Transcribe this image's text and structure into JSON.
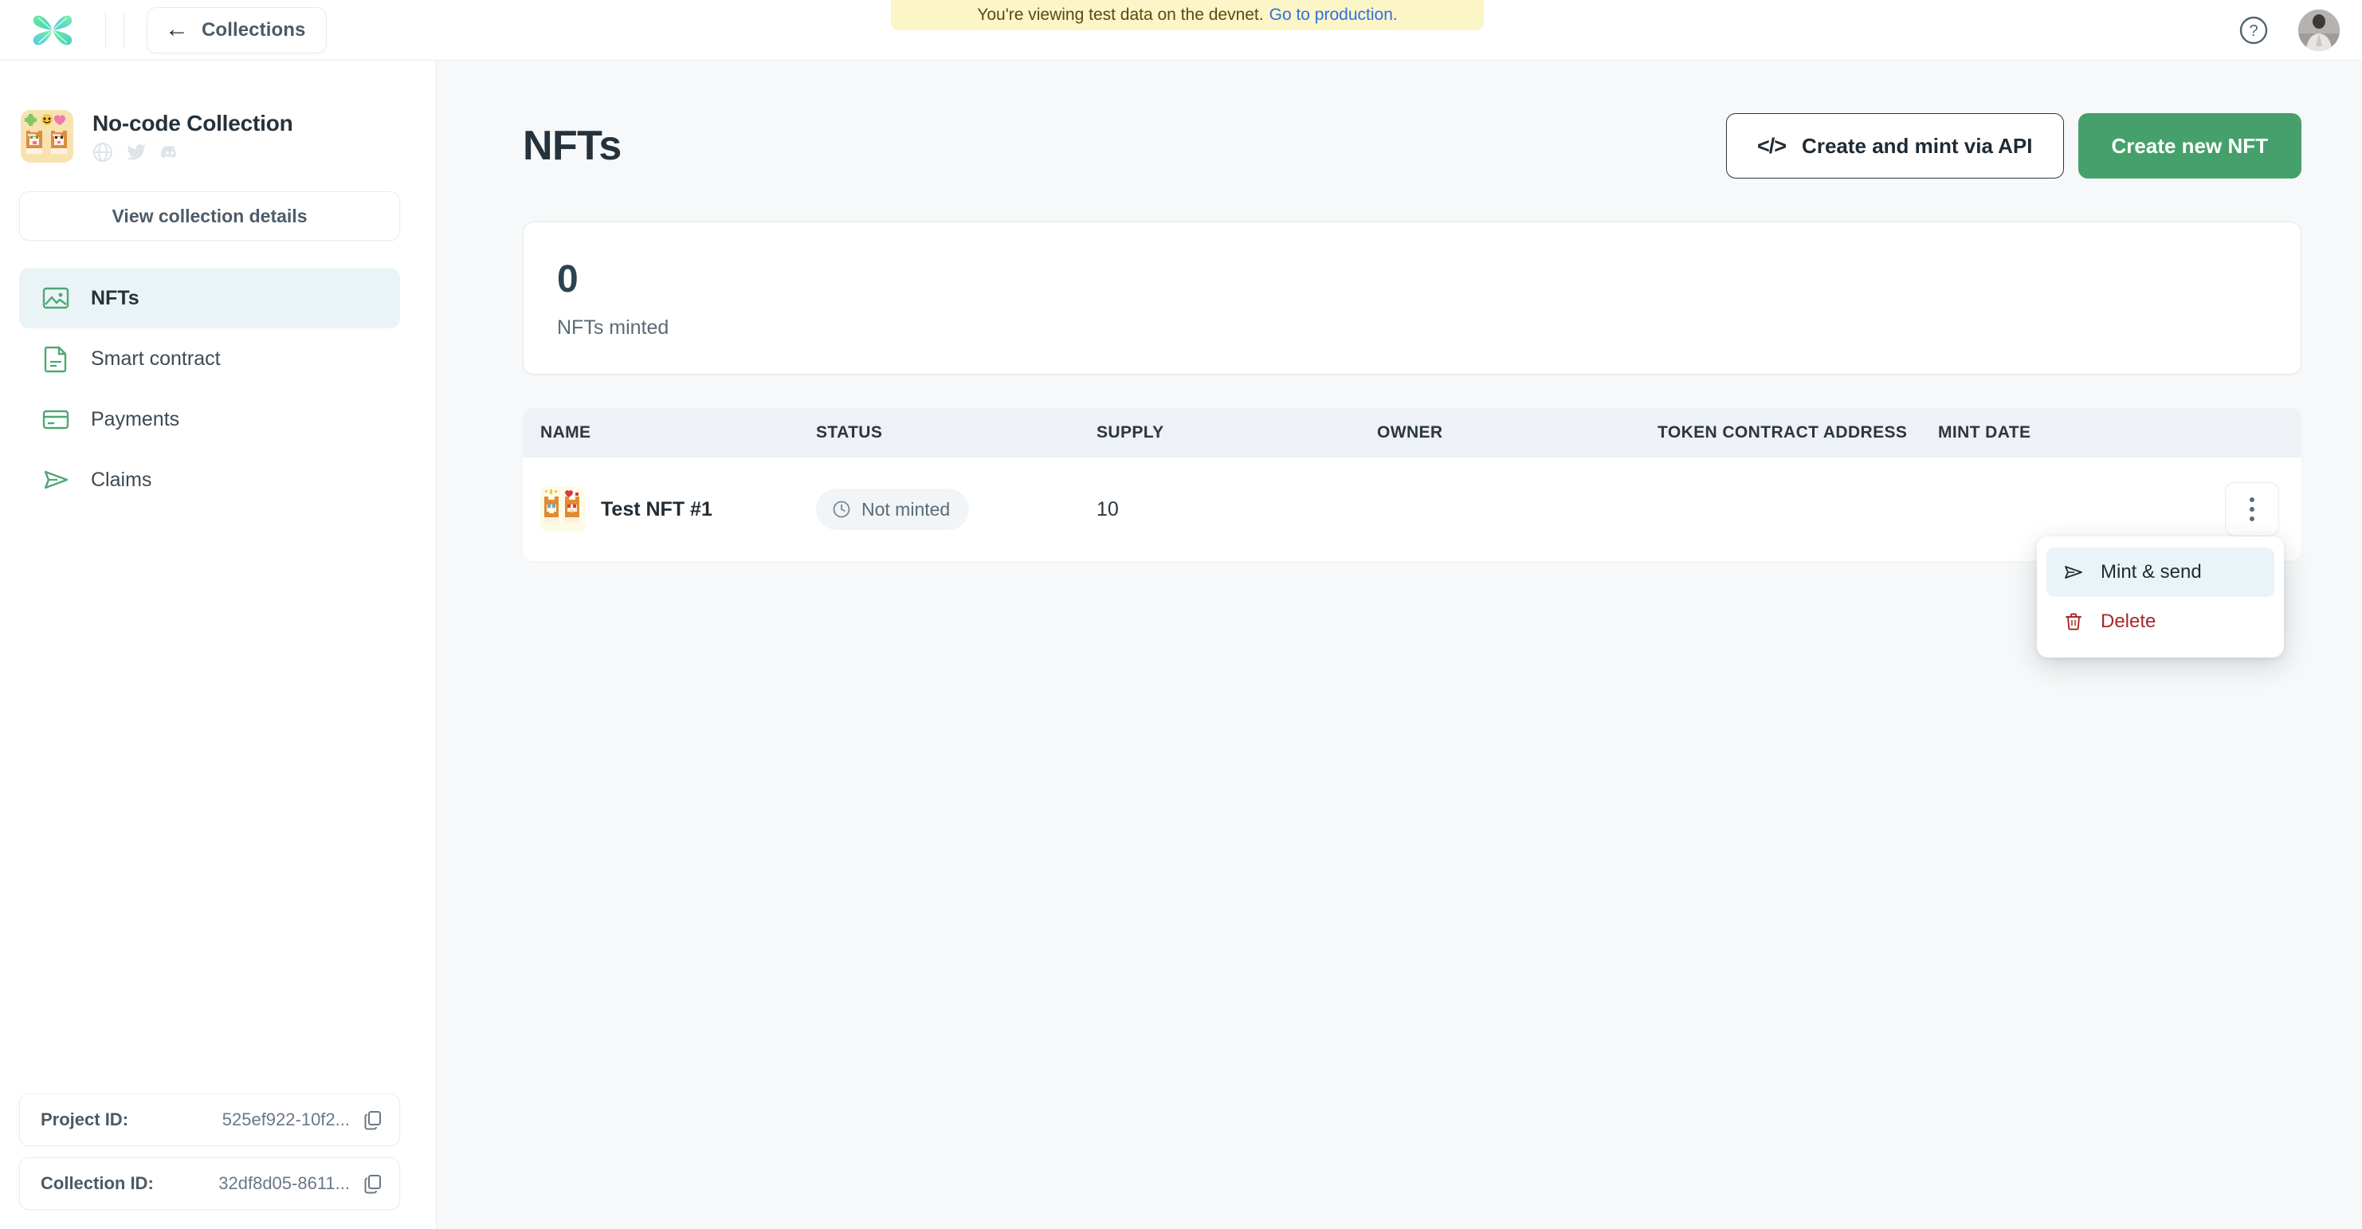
{
  "colors": {
    "accent_green": "#45a06b",
    "nav_icon_green": "#4fa873",
    "active_nav_bg": "#eaf4f7",
    "banner_bg": "#fbf5c8",
    "banner_link": "#2f6fe4",
    "danger_red": "#a62828",
    "main_bg": "#f6f8f9",
    "text_dark": "#26323b"
  },
  "topbar": {
    "logo_icon": "x-butterfly-logo",
    "back_button": {
      "label": "Collections",
      "icon": "arrow-left-icon"
    },
    "help_icon": "question-circle-icon",
    "avatar_icon": "user-avatar"
  },
  "banner": {
    "text": "You're viewing test data on the devnet.",
    "link_text": "Go to production."
  },
  "sidebar": {
    "collection": {
      "name": "No-code Collection",
      "avatar_icon": "collection-pixel-art-avatar",
      "socials": [
        {
          "name": "globe-icon"
        },
        {
          "name": "twitter-icon"
        },
        {
          "name": "discord-icon"
        }
      ]
    },
    "view_details_label": "View collection details",
    "items": [
      {
        "label": "NFTs",
        "icon": "image-icon",
        "active": true
      },
      {
        "label": "Smart contract",
        "icon": "document-icon",
        "active": false
      },
      {
        "label": "Payments",
        "icon": "credit-card-icon",
        "active": false
      },
      {
        "label": "Claims",
        "icon": "send-icon",
        "active": false
      }
    ],
    "ids": [
      {
        "label": "Project ID:",
        "value": "525ef922-10f2...",
        "copy_icon": "copy-icon"
      },
      {
        "label": "Collection ID:",
        "value": "32df8d05-8611...",
        "copy_icon": "copy-icon"
      }
    ]
  },
  "main": {
    "title": "NFTs",
    "actions": {
      "api_button": {
        "label": "Create and mint via API",
        "icon": "code-icon"
      },
      "create_button": {
        "label": "Create new NFT"
      }
    },
    "stats": {
      "value": "0",
      "label": "NFTs minted"
    },
    "table": {
      "columns": [
        "NAME",
        "STATUS",
        "SUPPLY",
        "OWNER",
        "TOKEN CONTRACT ADDRESS",
        "MINT DATE"
      ],
      "rows": [
        {
          "name": "Test NFT #1",
          "thumbnail_icon": "nft-pixel-art-thumbnail",
          "status": "Not minted",
          "status_icon": "clock-icon",
          "supply": "10",
          "owner": "",
          "token_contract_address": "",
          "mint_date": "",
          "menu_icon": "three-dots-vertical-icon"
        }
      ]
    },
    "row_menu": {
      "items": [
        {
          "label": "Mint & send",
          "icon": "send-icon",
          "highlighted": true,
          "danger": false
        },
        {
          "label": "Delete",
          "icon": "trash-icon",
          "highlighted": false,
          "danger": true
        }
      ]
    }
  }
}
